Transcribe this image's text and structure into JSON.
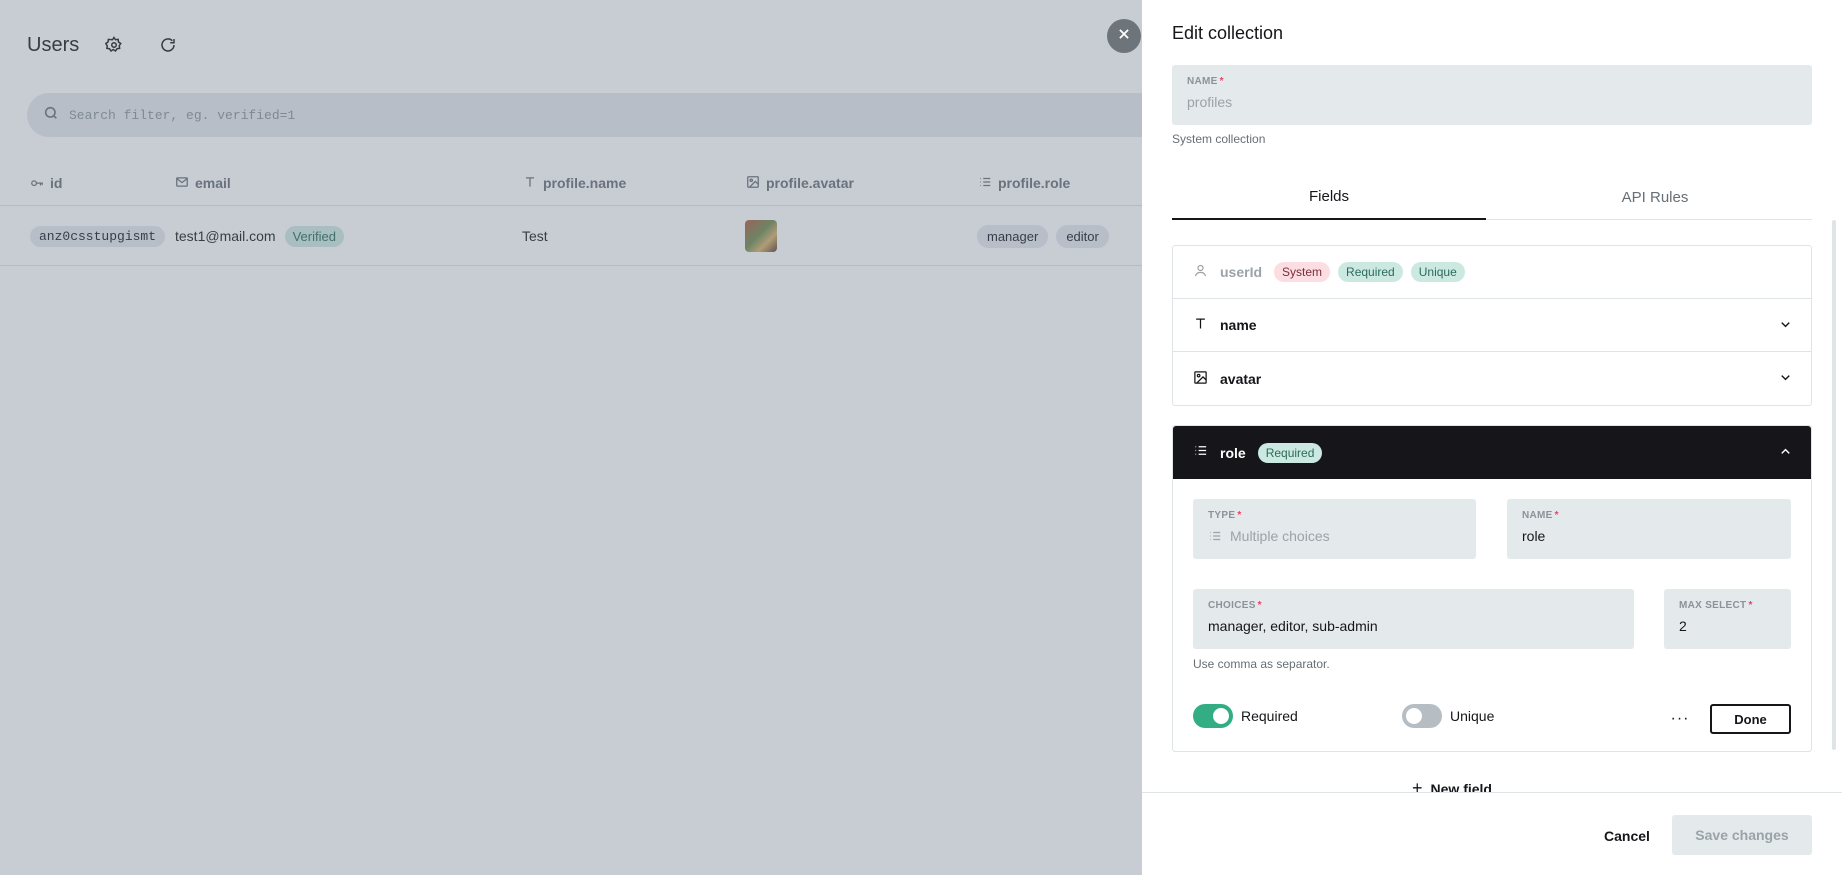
{
  "background": {
    "title": "Users",
    "header_icons": [
      "gear-icon",
      "refresh-icon"
    ],
    "search": {
      "placeholder": "Search filter, eg. verified=1"
    },
    "columns": [
      {
        "label": "id",
        "icon": "key-icon"
      },
      {
        "label": "email",
        "icon": "mail-icon"
      },
      {
        "label": "profile.name",
        "icon": "text-icon"
      },
      {
        "label": "profile.avatar",
        "icon": "image-icon"
      },
      {
        "label": "profile.role",
        "icon": "list-icon"
      }
    ],
    "rows": [
      {
        "id": "anz0csstupgismt",
        "email": "test1@mail.com",
        "verified_badge": "Verified",
        "name": "Test",
        "avatar": "avatar-thumbnail",
        "roles": [
          "manager",
          "editor"
        ]
      }
    ]
  },
  "panel": {
    "title": "Edit collection",
    "name_label": "NAME",
    "name_value": "profiles",
    "system_note": "System collection",
    "tabs": [
      "Fields",
      "API Rules"
    ],
    "active_tab": "Fields",
    "fields": [
      {
        "name": "userId",
        "icon": "user-icon",
        "badges": [
          "System",
          "Required",
          "Unique"
        ]
      },
      {
        "name": "name",
        "icon": "text-icon"
      },
      {
        "name": "avatar",
        "icon": "image-icon"
      }
    ],
    "active_field": {
      "name": "role",
      "icon": "list-icon",
      "badge": "Required",
      "type_label": "TYPE",
      "type_value": "Multiple choices",
      "name_label": "NAME",
      "name_value": "role",
      "choices_label": "CHOICES",
      "choices_value": "manager, editor, sub-admin",
      "max_select_label": "MAX SELECT",
      "max_select_value": "2",
      "help": "Use comma as separator.",
      "required_label": "Required",
      "required_on": true,
      "unique_label": "Unique",
      "unique_on": false,
      "more": "···",
      "done": "Done"
    },
    "new_field": "New field",
    "cancel": "Cancel",
    "save": "Save changes",
    "colors": {
      "accent": "#32ad84",
      "dark": "#16161a",
      "muted_bg": "#e4e9ec",
      "danger": "#e34562"
    }
  }
}
